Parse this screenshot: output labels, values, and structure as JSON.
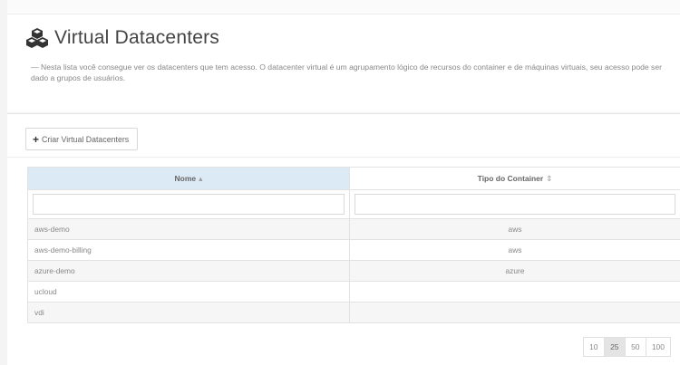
{
  "header": {
    "icon": "cubes-icon",
    "title": "Virtual Datacenters",
    "description": "— Nesta lista você consegue ver os datacenters que tem acesso. O datacenter virtual é um agrupamento lógico de recursos do container e de máquinas virtuais, seu acesso pode ser dado a grupos de usuários."
  },
  "toolbar": {
    "create_label": "Criar Virtual Datacenters"
  },
  "table": {
    "columns": [
      {
        "label": "Nome",
        "sort": "▴"
      },
      {
        "label": "Tipo do Container",
        "sort": "⇕"
      }
    ],
    "rows": [
      {
        "nome": "aws-demo",
        "tipo": "aws"
      },
      {
        "nome": "aws-demo-billing",
        "tipo": "aws"
      },
      {
        "nome": "azure-demo",
        "tipo": "azure"
      },
      {
        "nome": "ucloud",
        "tipo": ""
      },
      {
        "nome": "vdi",
        "tipo": ""
      }
    ]
  },
  "pagination": {
    "sizes": [
      "10",
      "25",
      "50",
      "100"
    ],
    "active": "25"
  },
  "colors": {
    "sorted_header": "#dceaf6",
    "active_page": "#e4e4e4"
  }
}
